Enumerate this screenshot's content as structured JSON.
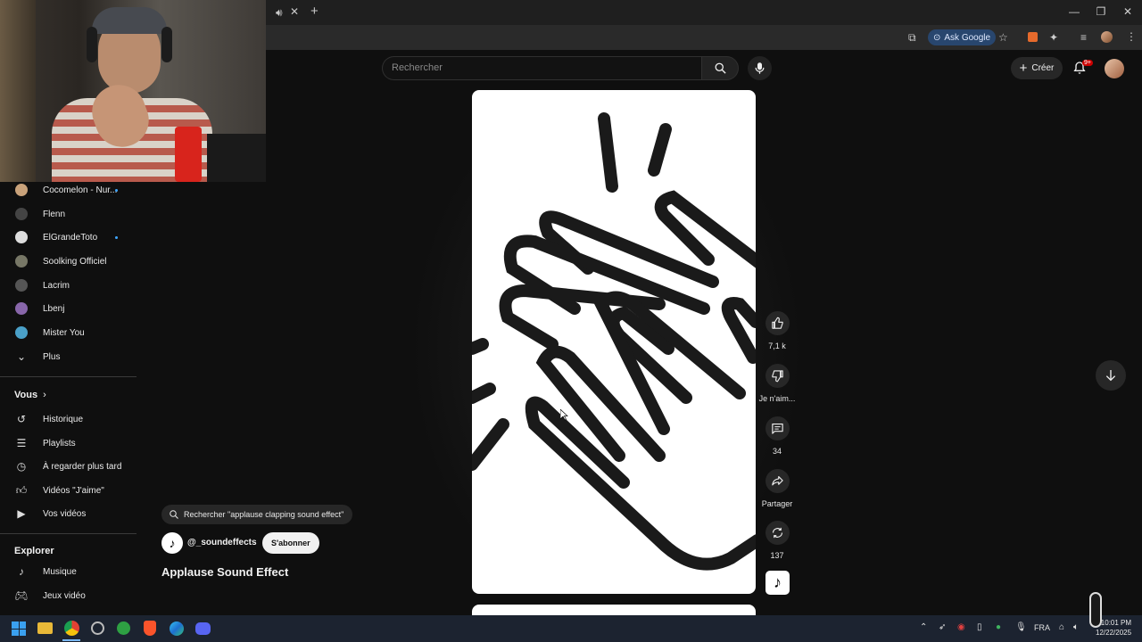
{
  "browser": {
    "ask_google": "Ask Google"
  },
  "header": {
    "search_placeholder": "Rechercher",
    "create_label": "Créer",
    "notif_badge": "9+"
  },
  "sidebar": {
    "subscriptions": [
      {
        "label": "Cocomelon - Nur...",
        "live": true,
        "color": "#c9a27a"
      },
      {
        "label": "Flenn",
        "live": false,
        "color": "#444444"
      },
      {
        "label": "ElGrandeToto",
        "live": true,
        "color": "#dddddd"
      },
      {
        "label": "Soolking Officiel",
        "live": false,
        "color": "#777766"
      },
      {
        "label": "Lacrim",
        "live": false,
        "color": "#555555"
      },
      {
        "label": "Lbenj",
        "live": false,
        "color": "#8866aa"
      },
      {
        "label": "Mister You",
        "live": false,
        "color": "#4aa0c8"
      }
    ],
    "more_label": "Plus",
    "you_heading": "Vous",
    "you_items": [
      {
        "label": "Historique",
        "icon": "history-icon"
      },
      {
        "label": "Playlists",
        "icon": "playlists-icon"
      },
      {
        "label": "À regarder plus tard",
        "icon": "watch-later-icon"
      },
      {
        "label": "Vidéos \"J'aime\"",
        "icon": "like-icon"
      },
      {
        "label": "Vos vidéos",
        "icon": "your-videos-icon"
      }
    ],
    "explore_heading": "Explorer",
    "explore_items": [
      {
        "label": "Musique",
        "icon": "music-icon"
      },
      {
        "label": "Jeux vidéo",
        "icon": "gaming-icon"
      }
    ]
  },
  "short": {
    "search_chip": "Rechercher \"applause clapping sound effect\"",
    "channel": "@_soundeffects",
    "subscribe_label": "S'abonner",
    "title": "Applause Sound Effect",
    "likes": "7,1 k",
    "dislike_label": "Je n'aim...",
    "comments": "34",
    "share_label": "Partager",
    "remix": "137"
  },
  "taskbar": {
    "language": "FRA",
    "time": "10:01 PM",
    "date": "12/22/2025"
  }
}
